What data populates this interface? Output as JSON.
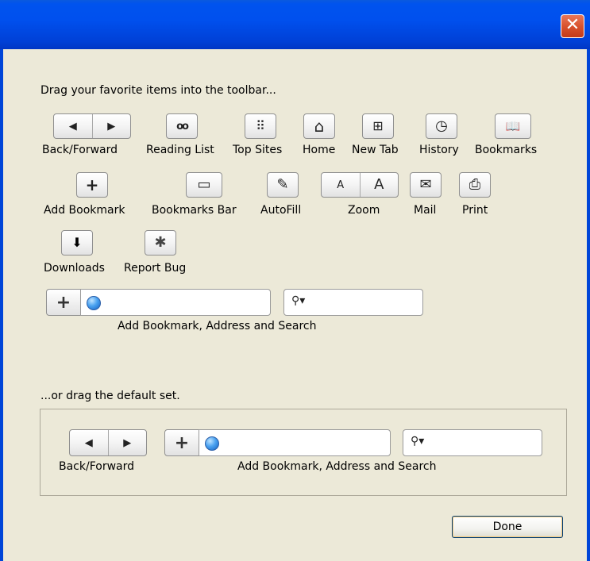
{
  "titlebar": {
    "close_icon": "close-x-icon",
    "close_glyph": "✕"
  },
  "palette": {
    "heading": "Drag your favorite items into the toolbar...",
    "items": [
      {
        "label": "Back/Forward",
        "icon": "back-forward-arrows-icon"
      },
      {
        "label": "Reading List",
        "icon": "glasses-icon"
      },
      {
        "label": "Top Sites",
        "icon": "grid-icon"
      },
      {
        "label": "Home",
        "icon": "house-icon"
      },
      {
        "label": "New Tab",
        "icon": "new-tab-icon"
      },
      {
        "label": "History",
        "icon": "clock-icon"
      },
      {
        "label": "Bookmarks",
        "icon": "open-book-icon"
      },
      {
        "label": "Add Bookmark",
        "icon": "plus-icon"
      },
      {
        "label": "Bookmarks Bar",
        "icon": "bookmarks-bar-icon"
      },
      {
        "label": "AutoFill",
        "icon": "pencil-form-icon"
      },
      {
        "label": "Zoom",
        "icon": "text-size-icon"
      },
      {
        "label": "Mail",
        "icon": "envelope-icon"
      },
      {
        "label": "Print",
        "icon": "printer-icon"
      },
      {
        "label": "Downloads",
        "icon": "download-arrow-icon"
      },
      {
        "label": "Report Bug",
        "icon": "bug-icon"
      }
    ],
    "combo_label": "Add Bookmark, Address and Search"
  },
  "default_set": {
    "heading": "...or drag the default set.",
    "back_forward_label": "Back/Forward",
    "combo_label": "Add Bookmark, Address and Search"
  },
  "glyphs": {
    "back": "◀",
    "forward": "▶",
    "plus": "+",
    "grid": "⠿",
    "home": "⌂",
    "new_tab": "⊞",
    "clock": "◷",
    "book": "📖",
    "bookmarks_bar": "▭",
    "autofill": "✎",
    "zoom_small": "A",
    "zoom_large": "A",
    "mail": "✉",
    "print": "⎙",
    "download": "⬇",
    "bug": "✱",
    "search": "⚲▾",
    "glasses": "oo"
  },
  "footer": {
    "done_label": "Done"
  }
}
